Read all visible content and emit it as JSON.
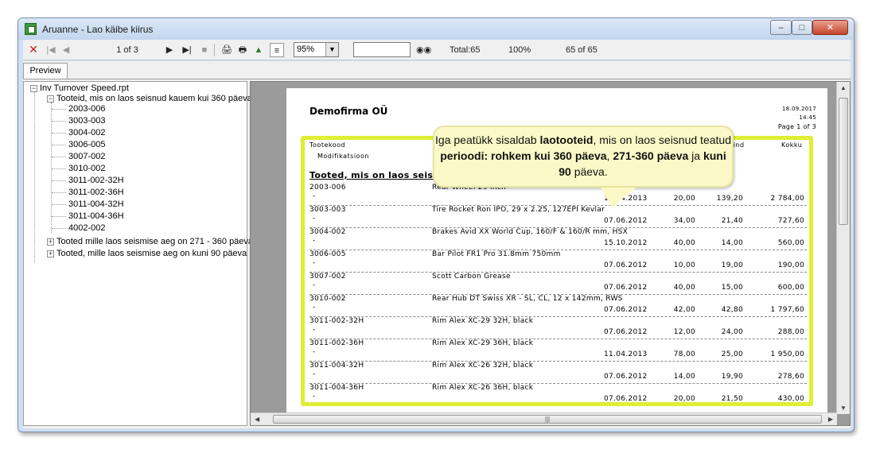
{
  "window": {
    "title": "Aruanne - Lao käibe kiirus"
  },
  "toolbar": {
    "page_indicator": "1 of 3",
    "zoom": "95%",
    "total": "Total:65",
    "percent": "100%",
    "count": "65 of 65"
  },
  "tabs": [
    {
      "label": "Preview"
    }
  ],
  "tree": {
    "root": "Inv Turnover Speed.rpt",
    "groups": [
      {
        "label": "Tooteid, mis on laos seisnud kauem kui 360 päeva",
        "expanded": true,
        "items": [
          "2003-006",
          "3003-003",
          "3004-002",
          "3006-005",
          "3007-002",
          "3010-002",
          "3011-002-32H",
          "3011-002-36H",
          "3011-004-32H",
          "3011-004-36H",
          "4002-002"
        ]
      },
      {
        "label": "Tooted mille laos seismise aeg on 271 - 360 päeva",
        "expanded": false,
        "items": []
      },
      {
        "label": "Tooted, mille laos seismise aeg on kuni 90 päeva",
        "expanded": false,
        "items": []
      }
    ]
  },
  "report": {
    "company": "Demofirma OÜ",
    "date": "18.09.2017",
    "time": "14:45",
    "page": "Page 1 of 3",
    "col_code": "Tootekood",
    "col_modification": "Modifikatsioon",
    "col_unit_price": "Ühiku hind",
    "col_total": "Kokku",
    "section": "Tooted, mis on laos seisnud kauem kui 360 päeva",
    "rows": [
      {
        "code": "2003-006",
        "desc": "Rear Wheel 29 inch",
        "mod": "-",
        "date": "11.04.2013",
        "qty": "20,00",
        "price": "139,20",
        "total": "2 784,00"
      },
      {
        "code": "3003-003",
        "desc": "Tire Rocket Ron IPO, 29 x 2.25, 127EPI Kevlar",
        "mod": "-",
        "date": "07.06.2012",
        "qty": "34,00",
        "price": "21,40",
        "total": "727,60"
      },
      {
        "code": "3004-002",
        "desc": "Brakes Avid XX World Cup, 160/F & 160/R mm, HSX",
        "mod": "-",
        "date": "15.10.2012",
        "qty": "40,00",
        "price": "14,00",
        "total": "560,00"
      },
      {
        "code": "3006-005",
        "desc": "Bar Pilot FR1 Pro 31.8mm 750mm",
        "mod": "-",
        "date": "07.06.2012",
        "qty": "10,00",
        "price": "19,00",
        "total": "190,00"
      },
      {
        "code": "3007-002",
        "desc": "Scott Carbon Grease",
        "mod": "-",
        "date": "07.06.2012",
        "qty": "40,00",
        "price": "15,00",
        "total": "600,00"
      },
      {
        "code": "3010-002",
        "desc": "Rear Hub DT Swiss XR - SL, CL, 12 x 142mm, RWS",
        "mod": "-",
        "date": "07.06.2012",
        "qty": "42,00",
        "price": "42,80",
        "total": "1 797,60"
      },
      {
        "code": "3011-002-32H",
        "desc": "Rim Alex XC-29 32H, black",
        "mod": "-",
        "date": "07.06.2012",
        "qty": "12,00",
        "price": "24,00",
        "total": "288,00"
      },
      {
        "code": "3011-002-36H",
        "desc": "Rim Alex XC-29 36H, black",
        "mod": "-",
        "date": "11.04.2013",
        "qty": "78,00",
        "price": "25,00",
        "total": "1 950,00"
      },
      {
        "code": "3011-004-32H",
        "desc": "Rim Alex XC-26 32H, black",
        "mod": "-",
        "date": "07.06.2012",
        "qty": "14,00",
        "price": "19,90",
        "total": "278,60"
      },
      {
        "code": "3011-004-36H",
        "desc": "Rim Alex XC-26 36H, black",
        "mod": "-",
        "date": "07.06.2012",
        "qty": "20,00",
        "price": "21,50",
        "total": "430,00"
      }
    ]
  },
  "callout": {
    "t1": "Iga peatükk sisaldab ",
    "b1": "laotooteid",
    "t2": ", mis on laos seisnud teatud ",
    "b2": "perioodi: rohkem kui 360 päeva",
    "t3": ", ",
    "b3": "271-360 päeva",
    "t4": " ja ",
    "b4": "kuni 90",
    "t5": " päeva."
  },
  "colors": {
    "highlight": "#e0ee35",
    "callout_bg": "#fbf9c7",
    "close_button": "#c4452b"
  }
}
